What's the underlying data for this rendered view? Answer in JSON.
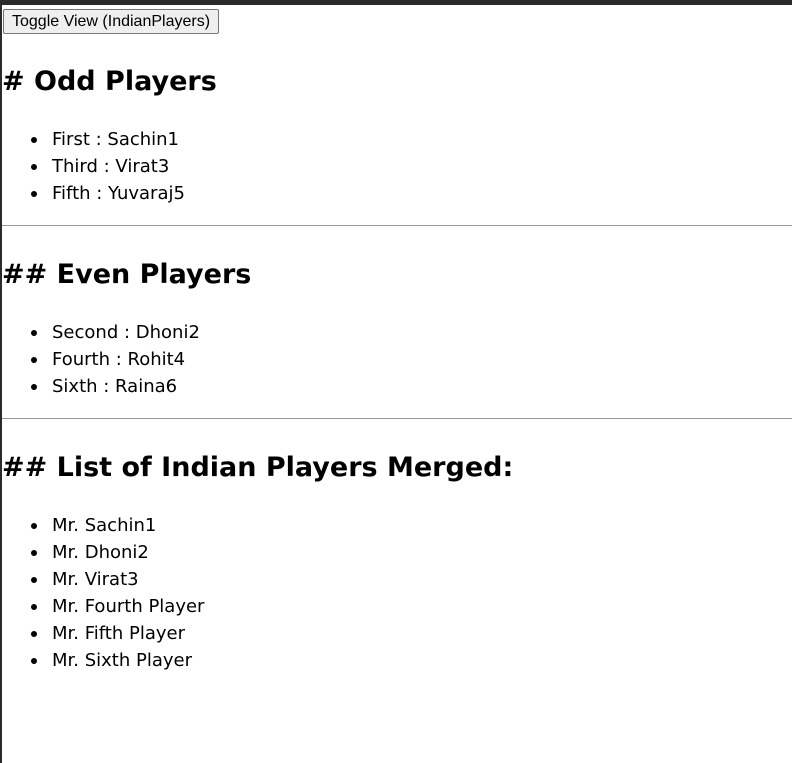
{
  "toggle_button": {
    "label": "Toggle View (IndianPlayers)"
  },
  "odd_section": {
    "title": "# Odd Players",
    "items": [
      "First : Sachin1",
      "Third : Virat3",
      "Fifth : Yuvaraj5"
    ]
  },
  "even_section": {
    "title": "## Even Players",
    "items": [
      "Second : Dhoni2",
      "Fourth : Rohit4",
      "Sixth : Raina6"
    ]
  },
  "merged_section": {
    "title": "## List of Indian Players Merged:",
    "items": [
      "Mr. Sachin1",
      "Mr. Dhoni2",
      "Mr. Virat3",
      "Mr. Fourth Player",
      "Mr. Fifth Player",
      "Mr. Sixth Player"
    ]
  }
}
